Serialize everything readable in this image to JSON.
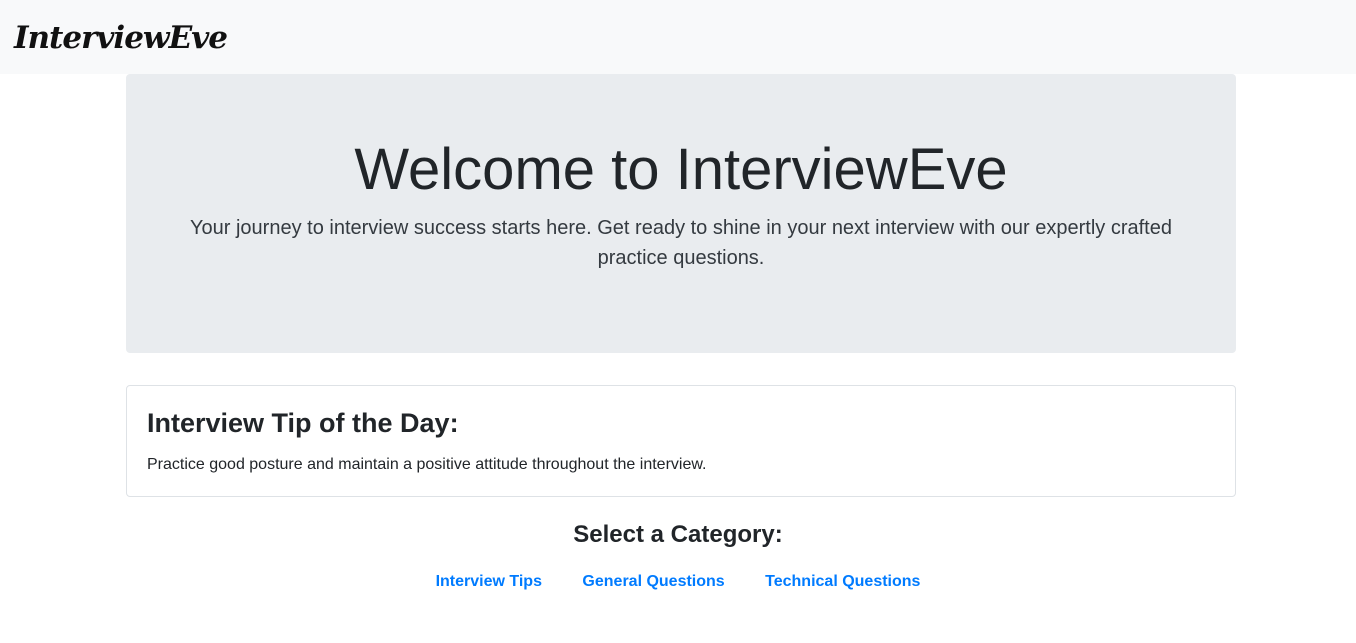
{
  "navbar": {
    "brand": "InterviewEve"
  },
  "hero": {
    "title": "Welcome to InterviewEve",
    "subtitle": "Your journey to interview success starts here. Get ready to shine in your next interview with our expertly crafted practice questions."
  },
  "tip": {
    "heading": "Interview Tip of the Day:",
    "text": "Practice good posture and maintain a positive attitude throughout the interview."
  },
  "categories": {
    "heading": "Select a Category:",
    "links": [
      {
        "label": "Interview Tips"
      },
      {
        "label": "General Questions"
      },
      {
        "label": "Technical Questions"
      }
    ]
  },
  "colors": {
    "navbar_bg": "#f8f9fa",
    "jumbotron_bg": "#e9ecef",
    "link": "#007bff"
  }
}
